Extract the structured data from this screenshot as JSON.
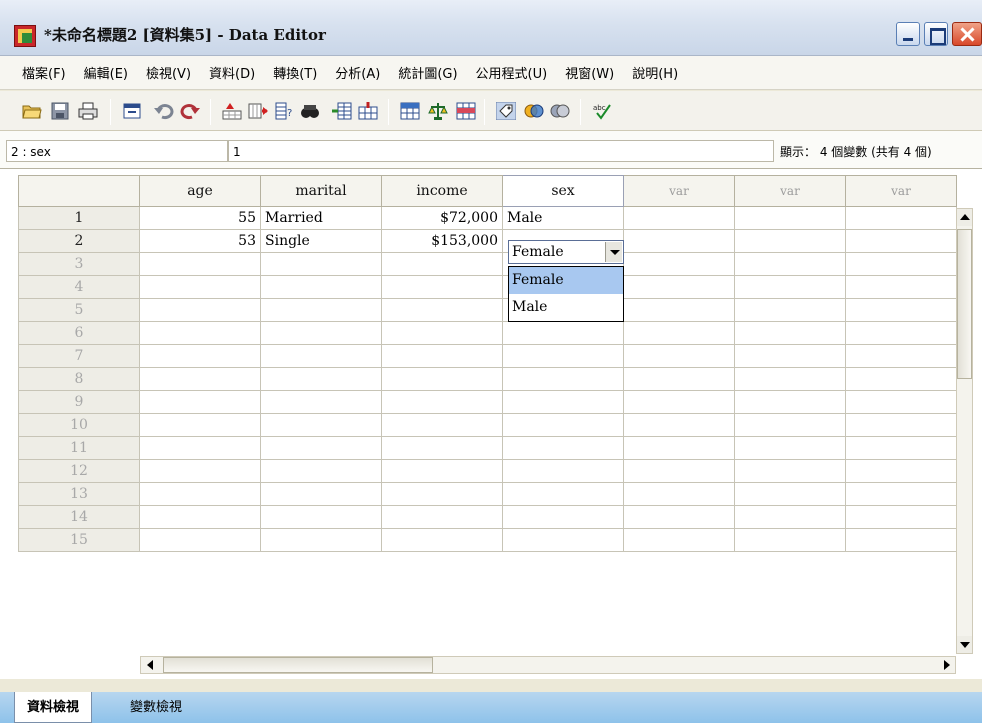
{
  "window": {
    "title": "*未命名標題2 [資料集5] - Data Editor"
  },
  "menu": [
    "檔案(F)",
    "編輯(E)",
    "檢視(V)",
    "資料(D)",
    "轉換(T)",
    "分析(A)",
    "統計圖(G)",
    "公用程式(U)",
    "視窗(W)",
    "說明(H)"
  ],
  "cell_info": {
    "reference": "2 : sex",
    "value": "1",
    "variable_count": "顯示： 4 個變數 (共有 4 個)"
  },
  "grid": {
    "columns": [
      "age",
      "marital",
      "income",
      "sex",
      "var",
      "var",
      "var"
    ],
    "row_numbers": [
      "1",
      "2",
      "3",
      "4",
      "5",
      "6",
      "7",
      "8",
      "9",
      "10",
      "11",
      "12",
      "13",
      "14",
      "15"
    ],
    "rows": [
      {
        "age": "55",
        "marital": "Married",
        "income": "$72,000",
        "sex": "Male"
      },
      {
        "age": "53",
        "marital": "Single",
        "income": "$153,000",
        "sex": "Female"
      }
    ]
  },
  "dropdown": {
    "current_value": "Female",
    "options": [
      "Female",
      "Male"
    ],
    "selected_index": 0
  },
  "tabs": {
    "data_view": "資料檢視",
    "variable_view": "變數檢視"
  },
  "toolbar_icons": [
    "open-folder-icon",
    "save-icon",
    "print-icon",
    "dialog-recall-icon",
    "undo-icon",
    "redo-icon",
    "goto-case-icon",
    "goto-variable-icon",
    "variables-icon",
    "find-icon",
    "insert-cases-icon",
    "insert-variable-icon",
    "split-file-icon",
    "weight-cases-icon",
    "select-cases-icon",
    "value-labels-icon",
    "use-sets-icon",
    "show-all-variables-icon",
    "spell-check-icon"
  ]
}
